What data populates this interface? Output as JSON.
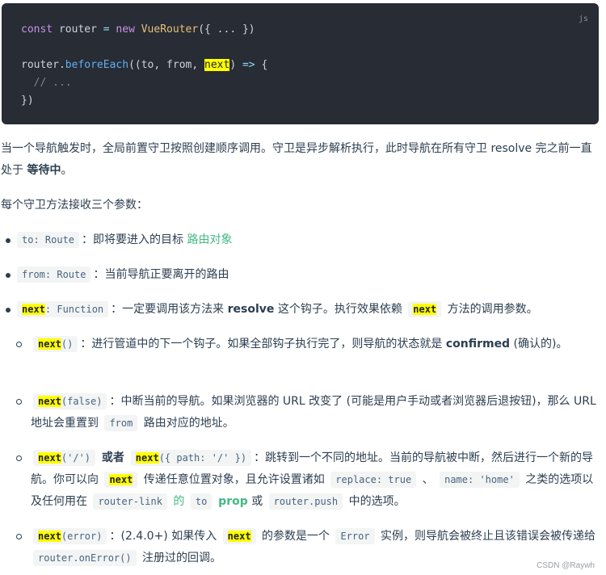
{
  "code": {
    "lang": "js",
    "l1": {
      "kw1": "const",
      "var": " router ",
      "op": "=",
      "kw2": " new ",
      "cls": "VueRouter",
      "rest": "({ ... })"
    },
    "l3": {
      "obj": "router.",
      "method": "beforeEach",
      "args1": "((to, from, ",
      "next": "next",
      "args2": ") ",
      "arrow": "=>",
      "brace": " {"
    },
    "l4": "  // ...",
    "l5": "})"
  },
  "p1": {
    "text1": "当一个导航触发时，全局前置守卫按照创建顺序调用。守卫是异步解析执行，此时导航在所有守卫 resolve 完之前一直处于 ",
    "bold": "等待中",
    "end": "。"
  },
  "p2": "每个守卫方法接收三个参数：",
  "items": {
    "to": {
      "code": "to: Route",
      "text": "：即将要进入的目标 ",
      "link": "路由对象"
    },
    "from": {
      "code": "from: Route",
      "text": "：当前导航正要离开的路由"
    },
    "next": {
      "code_hl": "next",
      "code_rest": ": Function",
      "text1": "：一定要调用该方法来 ",
      "bold": "resolve",
      "text2": " 这个钩子。执行效果依赖 ",
      "code2": "next",
      "text3": " 方法的调用参数。"
    }
  },
  "sub": {
    "s1": {
      "hl": "next",
      "rest": "()",
      "text1": "：进行管道中的下一个钩子。如果全部钩子执行完了，则导航的状态就是 ",
      "bold": "confirmed",
      "text2": " (确认的)。"
    },
    "s2": {
      "hl": "next",
      "rest": "(false)",
      "text1": "：中断当前的导航。如果浏览器的 URL 改变了 (可能是用户手动或者浏览器后退按钮)，那么 URL 地址会重置到 ",
      "code": "from",
      "text2": " 路由对应的地址。"
    },
    "s3": {
      "hl1": "next",
      "rest1": "('/')",
      "or": " 或者 ",
      "hl2": "next",
      "rest2": "({ path: '/' })",
      "text1": "：跳转到一个不同的地址。当前的导航被中断，然后进行一个新的导航。你可以向 ",
      "hl3": "next",
      "text2": " 传递任意位置对象，且允许设置诸如 ",
      "code1": "replace: true",
      "sep": " 、 ",
      "code2": "name: 'home'",
      "text3": " 之类的选项以及任何用在 ",
      "code3": "router-link",
      "link1": " 的 ",
      "code4": "to",
      "link2": " prop",
      "text4": " 或 ",
      "code5": "router.push",
      "text5": " 中的选项。"
    },
    "s4": {
      "hl": "next",
      "rest": "(error)",
      "text1": "：(2.4.0+) 如果传入 ",
      "hl2": "next",
      "text2": " 的参数是一个 ",
      "code1": "Error",
      "text3": " 实例，则导航会被终止且该错误会被传递给 ",
      "code2": "router.onError()",
      "text4": " 注册过的回调。"
    }
  },
  "watermark": "CSDN @Raywh"
}
